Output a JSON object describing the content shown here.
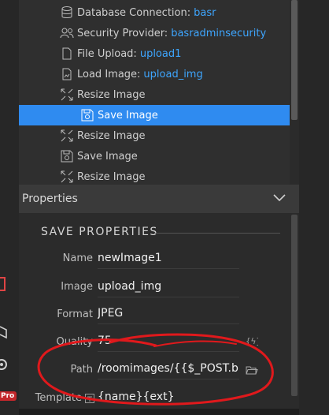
{
  "tree": {
    "items": [
      {
        "label": "Database Connection:",
        "value": "basr",
        "icon": "database-icon"
      },
      {
        "label": "Security Provider:",
        "value": "basradminsecurity",
        "icon": "users-icon"
      },
      {
        "label": "File Upload:",
        "value": "upload1",
        "icon": "file-icon"
      },
      {
        "label": "Load Image:",
        "value": "upload_img",
        "icon": "image-file-icon"
      },
      {
        "label": "Resize Image",
        "value": "",
        "icon": "resize-icon"
      },
      {
        "label": "Save Image",
        "value": "",
        "icon": "save-icon"
      },
      {
        "label": "Resize Image",
        "value": "",
        "icon": "resize-icon"
      },
      {
        "label": "Save Image",
        "value": "",
        "icon": "save-icon"
      },
      {
        "label": "Resize Image",
        "value": "",
        "icon": "resize-icon"
      }
    ]
  },
  "properties": {
    "header": "Properties",
    "section": "SAVE PROPERTIES",
    "fields": {
      "name": {
        "label": "Name",
        "value": "newImage1"
      },
      "image": {
        "label": "Image",
        "value": "upload_img"
      },
      "format": {
        "label": "Format",
        "value": "JPEG"
      },
      "quality": {
        "label": "Quality",
        "value": "75"
      },
      "path": {
        "label": "Path",
        "value": "/roomimages/{{$_POST.bid"
      },
      "template": {
        "label": "Template",
        "value": "{name}{ext}"
      }
    }
  },
  "sidebar": {
    "pro_badge": "Pro"
  },
  "colors": {
    "selection": "#2f8bf0",
    "link": "#3ea6ff",
    "annotation": "#e0191c"
  }
}
